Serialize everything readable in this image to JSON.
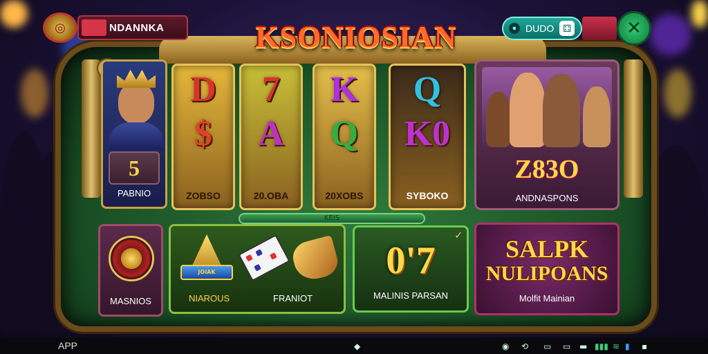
{
  "header": {
    "player_name": "NDANNKA",
    "game_title": "KSONIOSIAN",
    "video_button_label": "DUDO",
    "close_button_label": "✕"
  },
  "king_panel": {
    "count": "5",
    "label": "PABNIO"
  },
  "reels": [
    {
      "top_symbol": "D",
      "bottom_symbol": "$",
      "label": "ZOBSO",
      "bg": "#e6b83a",
      "top_color": "#d8342a",
      "bottom_color": "#e0402a"
    },
    {
      "top_symbol": "7",
      "bottom_symbol": "A",
      "label": "20.OBA",
      "bg": "#c8c038",
      "top_color": "#d8342a",
      "bottom_color": "#c030c0"
    },
    {
      "top_symbol": "K",
      "bottom_symbol": "Q",
      "label": "20XOBS",
      "bg": "#e6c04a",
      "top_color": "#b030e0",
      "bottom_color": "#30b040"
    },
    {
      "top_symbol": "Q",
      "bottom_symbol": "K0",
      "label": "SYBOKO",
      "bg": "#3a2a1a",
      "top_color": "#30c0e0",
      "bottom_color": "#c030d0"
    }
  ],
  "center_plaque": "KEIS",
  "group_panel": {
    "value": "Z83O",
    "label": "ANDNASPONS"
  },
  "wheel_panel": {
    "label": "MASNIOS"
  },
  "items_panel": {
    "horn_sign": "JOIAK",
    "left_label": "NIAROUS",
    "right_label": "FRANIOT"
  },
  "bonus_panel": {
    "value": "0'7",
    "label": "MALINIS PARSAN"
  },
  "jackpot_panel": {
    "line1": "SALPK",
    "line2": "NULIPOANS",
    "label": "Molfit Mainian"
  },
  "taskbar": {
    "app_label": "APP"
  }
}
